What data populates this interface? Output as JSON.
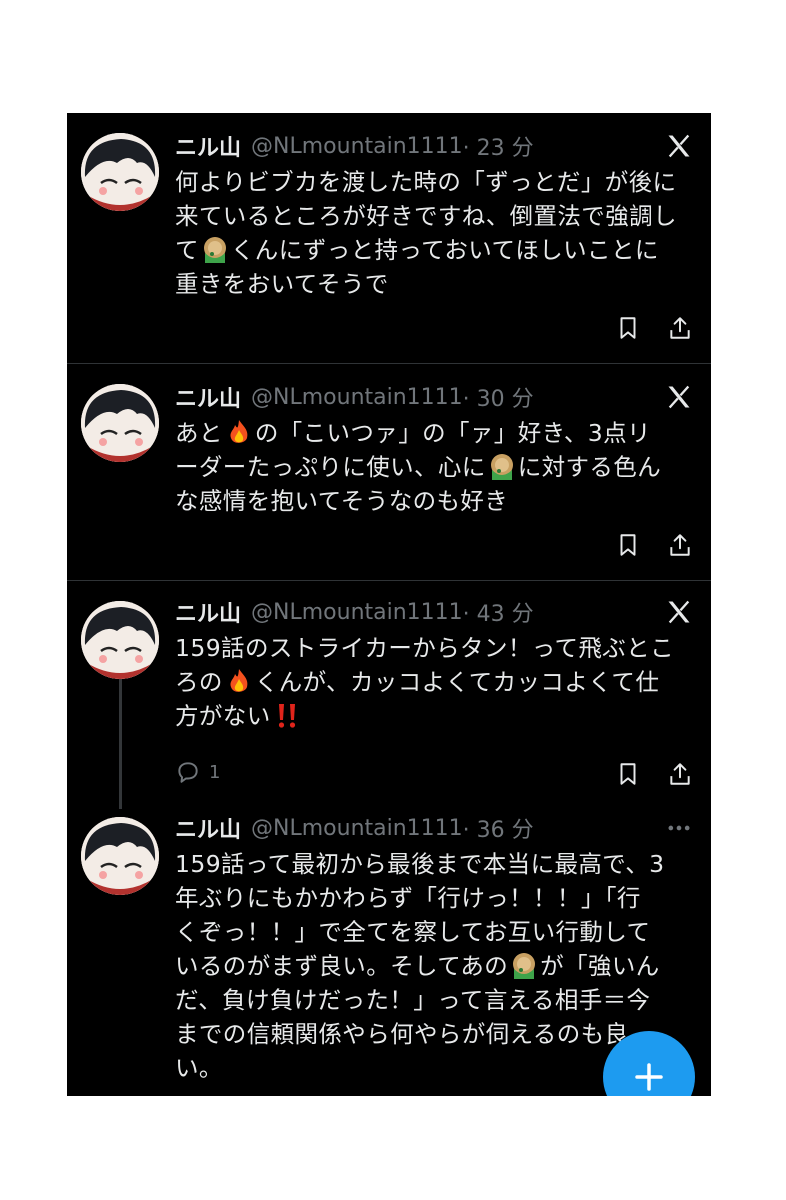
{
  "tweets": [
    {
      "name": "ニル山",
      "handle": "@NLmountain1111",
      "time": "· 23 分",
      "lines": [
        [
          "何よりビブカを渡した時の「ずっとだ」が後に"
        ],
        [
          "来ているところが好きですね、倒置法で強調し"
        ],
        [
          "て",
          "くんにずっと持っておいてほしいことに"
        ],
        [
          "重きをおいてそうで"
        ]
      ]
    },
    {
      "name": "ニル山",
      "handle": "@NLmountain1111",
      "time": "· 30 分",
      "lines": [
        [
          "あと",
          "の「こいつァ」の「ァ」好き、3点リ"
        ],
        [
          "ーダーたっぷりに使い、心に",
          "に対する色ん"
        ],
        [
          "な感情を抱いてそうなのも好き"
        ]
      ]
    },
    {
      "name": "ニル山",
      "handle": "@NLmountain1111",
      "time": "· 43 分",
      "lines": [
        [
          "159話のストライカーからタン！って飛ぶとこ"
        ],
        [
          "ろの",
          "くんが、カッコよくてカッコよくて仕"
        ],
        [
          "方がない"
        ]
      ],
      "reply_count": "1"
    },
    {
      "name": "ニル山",
      "handle": "@NLmountain1111",
      "time": "· 36 分",
      "lines": [
        [
          "159話って最初から最後まで本当に最高で、3"
        ],
        [
          "年ぶりにもかかわらず「行けっ！！！」「行"
        ],
        [
          "くぞっ！！」で全てを察してお互い行動して"
        ],
        [
          "いるのがまず良い。そしてあの",
          "が「強いん"
        ],
        [
          "だ、負け負けだった！」って言える相手＝今"
        ],
        [
          "までの信頼関係やら何やらが伺えるのも良"
        ],
        [
          "い。"
        ]
      ]
    }
  ],
  "icons": {
    "brand": "x-logo-icon",
    "more": "more-icon",
    "bookmark": "bookmark-icon",
    "share": "share-icon",
    "reply": "reply-icon",
    "compose": "plus-icon",
    "emoji_fire": "fire-emoji-icon",
    "emoji_green": "green-character-emoji-icon",
    "emoji_exclaim": "double-exclamation-icon"
  },
  "colors": {
    "background": "#000000",
    "text": "#e7e9ea",
    "secondary": "#71767b",
    "accent": "#1d9bf0"
  }
}
